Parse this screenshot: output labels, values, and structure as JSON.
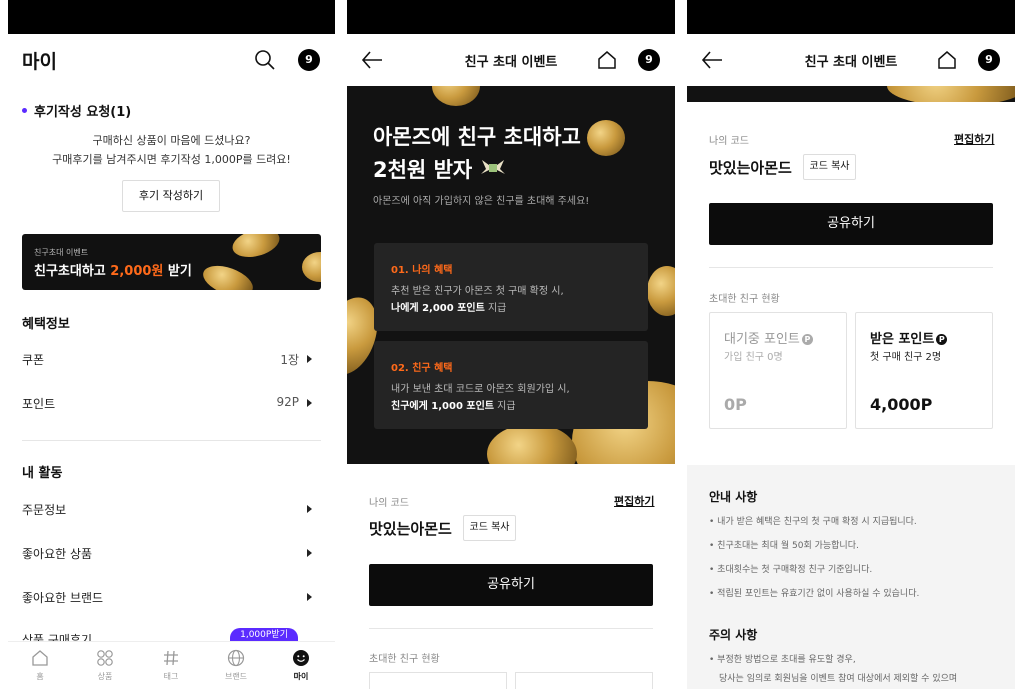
{
  "screen1": {
    "title": "마이",
    "badge_count": "9",
    "review": {
      "heading": "후기작성 요청(1)",
      "line1": "구매하신 상품이 마음에 드셨나요?",
      "line2": "구매후기를 남겨주시면 후기작성 1,000P를 드려요!",
      "button": "후기 작성하기"
    },
    "banner": {
      "small": "친구초대 이벤트",
      "main_prefix": "친구초대하고 ",
      "main_highlight": "2,000원",
      "main_suffix": " 받기"
    },
    "benefits_heading": "혜택정보",
    "coupon_label": "쿠폰",
    "coupon_value": "1장",
    "point_label": "포인트",
    "point_value": "92P",
    "activity_heading": "내 활동",
    "activity_items": [
      "주문정보",
      "좋아요한 상품",
      "좋아요한 브랜드",
      "상품 구매후기"
    ],
    "purchase_review_pill": "1,000P받기",
    "nav": [
      "홈",
      "상품",
      "태그",
      "브랜드",
      "마이"
    ],
    "accent_color": "#5b2bff",
    "highlight_color": "#ff6a1a"
  },
  "screen2": {
    "title": "친구 초대 이벤트",
    "badge_count": "9",
    "hero_line1": "아몬즈에 친구 초대하고",
    "hero_line2": "2천원 받자",
    "hero_sub": "아몬즈에 아직 가입하지 않은 친구를 초대해 주세요!",
    "card1": {
      "title": "01. 나의 혜택",
      "line1": "추천 받은 친구가 아몬즈 첫 구매 확정 시,",
      "line2_bold": "나에게 2,000 포인트",
      "line2_rest": " 지급"
    },
    "card2": {
      "title": "02. 친구 혜택",
      "line1": "내가 보낸 초대 코드로 아몬즈 회원가입 시,",
      "line2_bold": "친구에게 1,000 포인트",
      "line2_rest": " 지급"
    },
    "my_code_label": "나의 코드",
    "edit_link": "편집하기",
    "code": "맛있는아몬드",
    "copy_button": "코드 복사",
    "share_button": "공유하기",
    "friends_status": "초대한 친구 현황",
    "accent_color": "#ff6a1a"
  },
  "screen3": {
    "title": "친구 초대 이벤트",
    "badge_count": "9",
    "my_code_label": "나의 코드",
    "edit_link": "편집하기",
    "code": "맛있는아몬드",
    "copy_button": "코드 복사",
    "share_button": "공유하기",
    "friends_status": "초대한 친구 현황",
    "pending": {
      "label": "대기중 포인트",
      "sub": "가입 친구 0명",
      "value": "0P"
    },
    "received": {
      "label": "받은 포인트",
      "sub": "첫 구매 친구 2명",
      "value": "4,000P"
    },
    "notice_heading": "안내 사항",
    "notices": [
      "• 내가 받은 혜택은 친구의 첫 구매 확정 시 지급됩니다.",
      "• 친구초대는 최대 월 50회 가능합니다.",
      "• 초대횟수는 첫 구매확정 친구 기준입니다.",
      "• 적립된 포인트는 유효기간 없이 사용하실 수 있습니다."
    ],
    "caution_heading": "주의 사항",
    "cautions": [
      "• 부정한 방법으로 초대를 유도할 경우,",
      "당사는 임의로 회원님을 이벤트 참여 대상에서 제외할 수 있으며"
    ]
  }
}
